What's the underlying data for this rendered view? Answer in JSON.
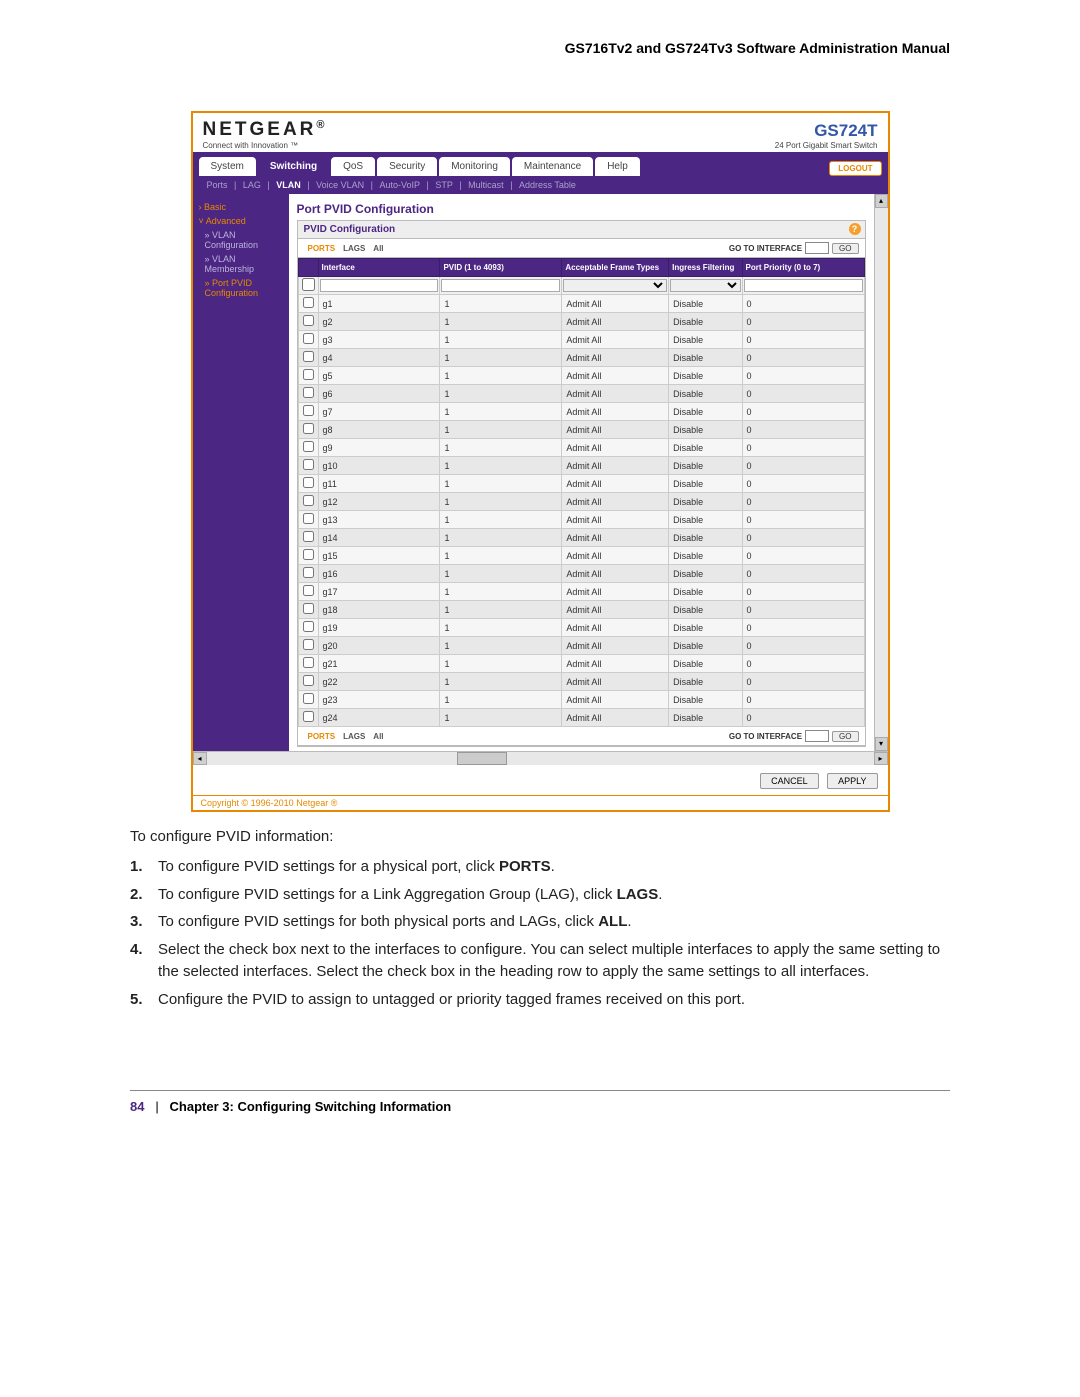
{
  "doc_title": "GS716Tv2 and GS724Tv3 Software Administration Manual",
  "logo": "NETGEAR",
  "tagline": "Connect with Innovation ™",
  "product": {
    "model": "GS724T",
    "desc": "24 Port Gigabit Smart Switch"
  },
  "logout": "LOGOUT",
  "tabs": [
    "System",
    "Switching",
    "QoS",
    "Security",
    "Monitoring",
    "Maintenance",
    "Help"
  ],
  "active_tab": "Switching",
  "subnav": [
    "Ports",
    "LAG",
    "VLAN",
    "Voice VLAN",
    "Auto-VoIP",
    "STP",
    "Multicast",
    "Address Table"
  ],
  "active_subnav": "VLAN",
  "sidebar": {
    "basic": "Basic",
    "advanced": "Advanced",
    "items": [
      {
        "label": "VLAN Configuration",
        "active": false
      },
      {
        "label": "VLAN Membership",
        "active": false
      },
      {
        "label": "Port PVID Configuration",
        "active": true
      }
    ]
  },
  "main_title": "Port PVID Configuration",
  "conf_header": "PVID Configuration",
  "tabs2": {
    "ports": "PORTS",
    "lags": "LAGS",
    "all": "All"
  },
  "goto_label": "GO TO INTERFACE",
  "go": "GO",
  "columns": [
    "",
    "Interface",
    "PVID (1 to 4093)",
    "Acceptable Frame Types",
    "Ingress Filtering",
    "Port Priority (0 to 7)"
  ],
  "rows": [
    {
      "iface": "g1",
      "pvid": "1",
      "aft": "Admit All",
      "ing": "Disable",
      "pri": "0"
    },
    {
      "iface": "g2",
      "pvid": "1",
      "aft": "Admit All",
      "ing": "Disable",
      "pri": "0"
    },
    {
      "iface": "g3",
      "pvid": "1",
      "aft": "Admit All",
      "ing": "Disable",
      "pri": "0"
    },
    {
      "iface": "g4",
      "pvid": "1",
      "aft": "Admit All",
      "ing": "Disable",
      "pri": "0"
    },
    {
      "iface": "g5",
      "pvid": "1",
      "aft": "Admit All",
      "ing": "Disable",
      "pri": "0"
    },
    {
      "iface": "g6",
      "pvid": "1",
      "aft": "Admit All",
      "ing": "Disable",
      "pri": "0"
    },
    {
      "iface": "g7",
      "pvid": "1",
      "aft": "Admit All",
      "ing": "Disable",
      "pri": "0"
    },
    {
      "iface": "g8",
      "pvid": "1",
      "aft": "Admit All",
      "ing": "Disable",
      "pri": "0"
    },
    {
      "iface": "g9",
      "pvid": "1",
      "aft": "Admit All",
      "ing": "Disable",
      "pri": "0"
    },
    {
      "iface": "g10",
      "pvid": "1",
      "aft": "Admit All",
      "ing": "Disable",
      "pri": "0"
    },
    {
      "iface": "g11",
      "pvid": "1",
      "aft": "Admit All",
      "ing": "Disable",
      "pri": "0"
    },
    {
      "iface": "g12",
      "pvid": "1",
      "aft": "Admit All",
      "ing": "Disable",
      "pri": "0"
    },
    {
      "iface": "g13",
      "pvid": "1",
      "aft": "Admit All",
      "ing": "Disable",
      "pri": "0"
    },
    {
      "iface": "g14",
      "pvid": "1",
      "aft": "Admit All",
      "ing": "Disable",
      "pri": "0"
    },
    {
      "iface": "g15",
      "pvid": "1",
      "aft": "Admit All",
      "ing": "Disable",
      "pri": "0"
    },
    {
      "iface": "g16",
      "pvid": "1",
      "aft": "Admit All",
      "ing": "Disable",
      "pri": "0"
    },
    {
      "iface": "g17",
      "pvid": "1",
      "aft": "Admit All",
      "ing": "Disable",
      "pri": "0"
    },
    {
      "iface": "g18",
      "pvid": "1",
      "aft": "Admit All",
      "ing": "Disable",
      "pri": "0"
    },
    {
      "iface": "g19",
      "pvid": "1",
      "aft": "Admit All",
      "ing": "Disable",
      "pri": "0"
    },
    {
      "iface": "g20",
      "pvid": "1",
      "aft": "Admit All",
      "ing": "Disable",
      "pri": "0"
    },
    {
      "iface": "g21",
      "pvid": "1",
      "aft": "Admit All",
      "ing": "Disable",
      "pri": "0"
    },
    {
      "iface": "g22",
      "pvid": "1",
      "aft": "Admit All",
      "ing": "Disable",
      "pri": "0"
    },
    {
      "iface": "g23",
      "pvid": "1",
      "aft": "Admit All",
      "ing": "Disable",
      "pri": "0"
    },
    {
      "iface": "g24",
      "pvid": "1",
      "aft": "Admit All",
      "ing": "Disable",
      "pri": "0"
    }
  ],
  "cancel": "CANCEL",
  "apply": "APPLY",
  "copyright": "Copyright © 1996-2010 Netgear ®",
  "instructions": {
    "intro": "To configure PVID information:",
    "steps": [
      "To configure PVID settings for a physical port, click <b>PORTS</b>.",
      "To configure PVID settings for a Link Aggregation Group (LAG), click <b>LAGS</b>.",
      "To configure PVID settings for both physical ports and LAGs, click <b>ALL</b>.",
      "Select the check box next to the interfaces to configure. You can select multiple interfaces to apply the same setting to the selected interfaces. Select the check box in the heading row to apply the same settings to all interfaces.",
      "Configure the PVID to assign to untagged or priority tagged frames received on this port."
    ]
  },
  "footer": {
    "page": "84",
    "sep": "|",
    "chapter": "Chapter 3:  Configuring Switching Information"
  }
}
